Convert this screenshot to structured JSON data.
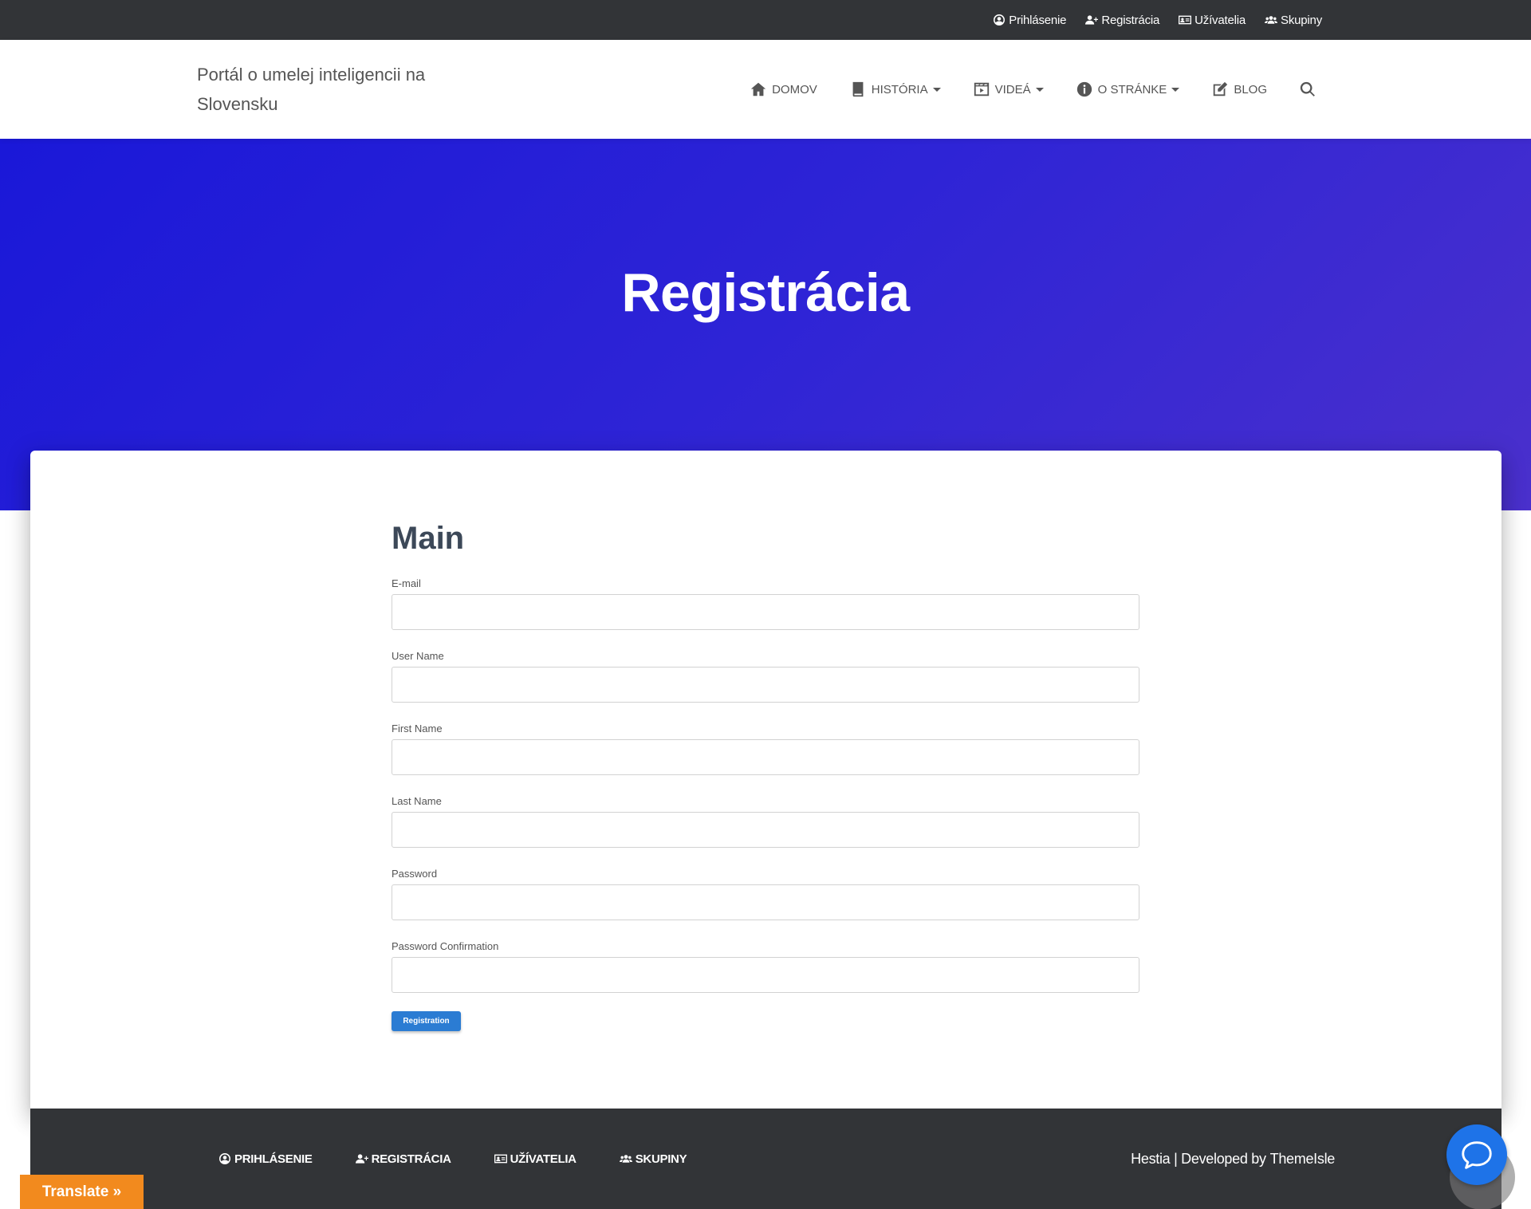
{
  "topbar": {
    "items": [
      {
        "label": "Prihlásenie",
        "icon": "user-circle-icon"
      },
      {
        "label": "Registrácia",
        "icon": "user-plus-icon"
      },
      {
        "label": "Užívatelia",
        "icon": "id-card-icon"
      },
      {
        "label": "Skupiny",
        "icon": "users-icon"
      }
    ]
  },
  "header": {
    "brand": "Portál o umelej inteligencii na Slovensku",
    "nav": [
      {
        "label": "Domov",
        "icon": "home-icon"
      },
      {
        "label": "História",
        "icon": "book-icon"
      },
      {
        "label": "Videá",
        "icon": "film-icon"
      },
      {
        "label": "O stránke",
        "icon": "info-icon"
      },
      {
        "label": "Blog",
        "icon": "edit-icon"
      }
    ],
    "search_icon": "search-icon"
  },
  "hero": {
    "title": "Registrácia"
  },
  "form": {
    "heading": "Main",
    "fields": [
      {
        "label": "E-mail",
        "value": ""
      },
      {
        "label": "User Name",
        "value": ""
      },
      {
        "label": "First Name",
        "value": ""
      },
      {
        "label": "Last Name",
        "value": ""
      },
      {
        "label": "Password",
        "value": ""
      },
      {
        "label": "Password Confirmation",
        "value": ""
      }
    ],
    "submit_label": "Registration"
  },
  "footer": {
    "items": [
      {
        "label": "Prihlásenie",
        "icon": "user-circle-icon"
      },
      {
        "label": "Registrácia",
        "icon": "user-plus-icon"
      },
      {
        "label": "Užívatelia",
        "icon": "id-card-icon"
      },
      {
        "label": "Skupiny",
        "icon": "users-icon"
      }
    ],
    "credit_text": "Hestia | Developed by",
    "credit_link": "ThemeIsle"
  },
  "translate": {
    "label": "Translate »"
  },
  "chat": {
    "icon": "chat-bubble-icon"
  },
  "colors": {
    "topbar": "#323437",
    "hero_start": "#1a18d8",
    "hero_end": "#4a30cc",
    "button": "#2b7cd3",
    "translate": "#f28a1e",
    "chat": "#1e73e8"
  }
}
